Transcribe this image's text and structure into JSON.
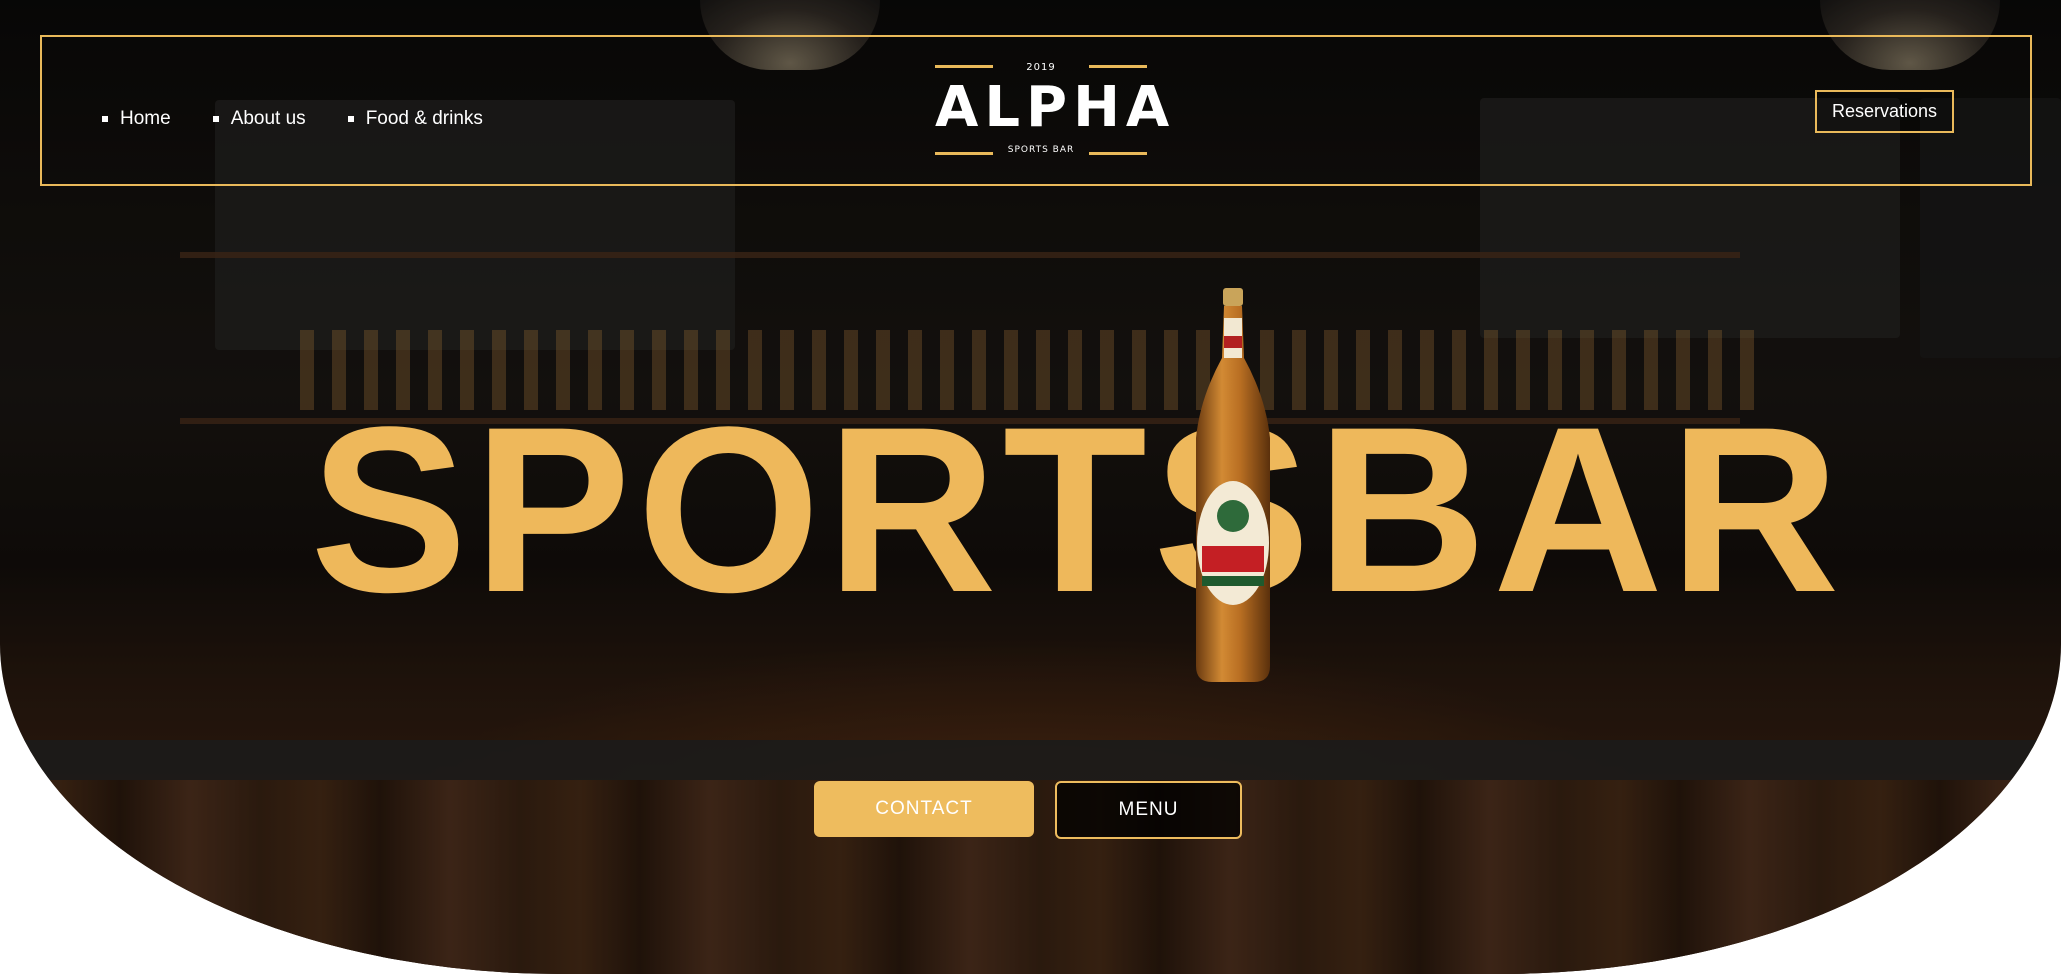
{
  "nav": {
    "items": [
      {
        "label": "Home"
      },
      {
        "label": "About us"
      },
      {
        "label": "Food & drinks"
      }
    ],
    "reservations_label": "Reservations"
  },
  "logo": {
    "year": "2019",
    "name": "ALPHA",
    "subtitle": "SPORTS BAR"
  },
  "hero": {
    "title": "SPORTSBAR",
    "contact_label": "CONTACT",
    "menu_label": "MENU"
  },
  "colors": {
    "accent": "#eeb85b",
    "text": "#ffffff",
    "background": "#15120f"
  }
}
